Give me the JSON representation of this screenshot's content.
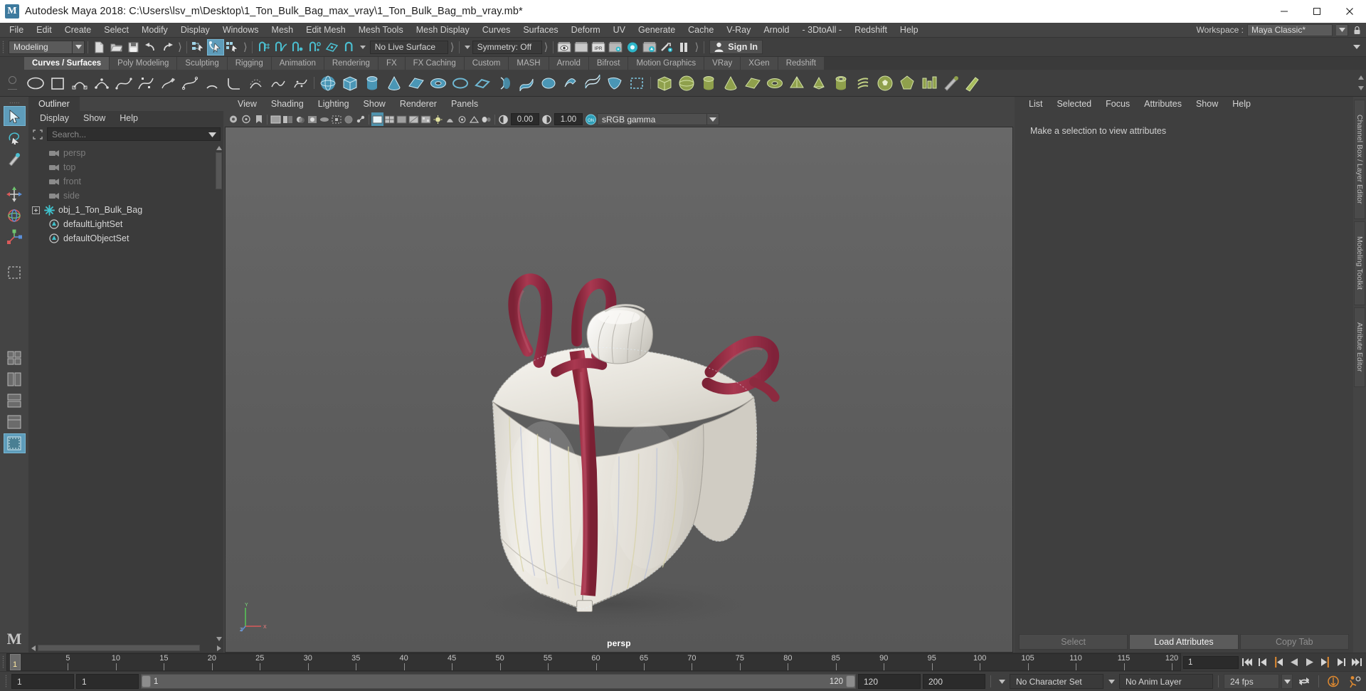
{
  "window": {
    "title": "Autodesk Maya 2018: C:\\Users\\lsv_m\\Desktop\\1_Ton_Bulk_Bag_max_vray\\1_Ton_Bulk_Bag_mb_vray.mb*",
    "logo_letter": "M",
    "minimize": "─",
    "maximize": "□",
    "close": "✕"
  },
  "menubar": {
    "items": [
      "File",
      "Edit",
      "Create",
      "Select",
      "Modify",
      "Display",
      "Windows",
      "Mesh",
      "Edit Mesh",
      "Mesh Tools",
      "Mesh Display",
      "Curves",
      "Surfaces",
      "Deform",
      "UV",
      "Generate",
      "Cache",
      "V-Ray",
      "Arnold",
      "- 3DtoAll -",
      "Redshift",
      "Help"
    ],
    "workspace_label": "Workspace :",
    "workspace_value": "Maya Classic*"
  },
  "statusline": {
    "mode": "Modeling",
    "live_surface": "No Live Surface",
    "symmetry": "Symmetry: Off",
    "signin": "Sign In",
    "icons": [
      "new-scene-icon",
      "open-scene-icon",
      "save-scene-icon",
      "undo-icon",
      "redo-icon",
      "select-by-hierarchy-icon",
      "select-by-object-icon",
      "select-by-component-icon",
      "snap-to-grid-icon",
      "snap-to-curve-icon",
      "snap-to-point-icon",
      "snap-to-projected-center-icon",
      "snap-to-view-plane-icon",
      "magnet-icon",
      "render-current-frame-icon",
      "render-sequence-icon",
      "ipr-render-icon",
      "render-settings-icon",
      "hypershade-icon",
      "render-view-icon",
      "render-setup-icon",
      "pause-render-icon"
    ]
  },
  "shelf": {
    "tabs": [
      "Curves / Surfaces",
      "Poly Modeling",
      "Sculpting",
      "Rigging",
      "Animation",
      "Rendering",
      "FX",
      "FX Caching",
      "Custom",
      "MASH",
      "Arnold",
      "Bifrost",
      "Motion Graphics",
      "VRay",
      "XGen",
      "Redshift"
    ],
    "selected_tab": "Curves / Surfaces"
  },
  "toolbox": {
    "items": [
      "select-tool",
      "lasso-select-tool",
      "paint-select-tool",
      "move-tool",
      "rotate-tool",
      "scale-tool",
      "last-tool",
      "four-view-layout",
      "persp-outliner-layout",
      "persp-graph-layout",
      "persp-hypershade-layout",
      "single-perspective-layout"
    ]
  },
  "outliner": {
    "tab_label": "Outliner",
    "menus": [
      "Display",
      "Show",
      "Help"
    ],
    "search_placeholder": "Search...",
    "search_value": "",
    "items": [
      {
        "label": "persp",
        "icon": "camera-icon",
        "dim": true,
        "expander": false
      },
      {
        "label": "top",
        "icon": "camera-icon",
        "dim": true,
        "expander": false
      },
      {
        "label": "front",
        "icon": "camera-icon",
        "dim": true,
        "expander": false
      },
      {
        "label": "side",
        "icon": "camera-icon",
        "dim": true,
        "expander": false
      },
      {
        "label": "obj_1_Ton_Bulk_Bag",
        "icon": "transform-icon",
        "dim": false,
        "expander": true
      },
      {
        "label": "defaultLightSet",
        "icon": "set-icon",
        "dim": false,
        "expander": false
      },
      {
        "label": "defaultObjectSet",
        "icon": "set-icon",
        "dim": false,
        "expander": false
      }
    ]
  },
  "viewport": {
    "menus": [
      "View",
      "Shading",
      "Lighting",
      "Show",
      "Renderer",
      "Panels"
    ],
    "camera_label": "persp",
    "exposure": "0.00",
    "gamma": "1.00",
    "color_space": "sRGB gamma",
    "gamma_toggle": "ON",
    "axis_labels": {
      "y": "Y",
      "x": "X",
      "z": "Z"
    }
  },
  "attribute_editor": {
    "menus": [
      "List",
      "Selected",
      "Focus",
      "Attributes",
      "Show",
      "Help"
    ],
    "empty_message": "Make a selection to view attributes",
    "buttons": [
      "Select",
      "Load Attributes",
      "Copy Tab"
    ],
    "active_button": "Load Attributes"
  },
  "right_tabs": [
    "Channel Box / Layer Editor",
    "Modeling Toolkit",
    "Attribute Editor"
  ],
  "timeline": {
    "current_frame": "1",
    "ticks": [
      5,
      10,
      15,
      20,
      25,
      30,
      35,
      40,
      45,
      50,
      55,
      60,
      65,
      70,
      75,
      80,
      85,
      90,
      95,
      100,
      105,
      110,
      115,
      120
    ],
    "range_start": 1,
    "range_end": 120,
    "playback_buttons": [
      "go-to-start-icon",
      "step-back-frame-icon",
      "step-back-key-icon",
      "play-backwards-icon",
      "play-forwards-icon",
      "step-forward-key-icon",
      "step-forward-frame-icon",
      "go-to-end-icon"
    ]
  },
  "bottombar": {
    "anim_start": "1",
    "range_start": "1",
    "slider_left": "1",
    "slider_right": "120",
    "range_end": "120",
    "anim_end": "200",
    "character_set": "No Character Set",
    "anim_layer": "No Anim Layer",
    "fps": "24 fps",
    "icons": [
      "auto-keyframe-toggle-icon",
      "animation-preferences-icon",
      "loop-playback-icon"
    ]
  },
  "colors": {
    "accent": "#5e9cba",
    "panel_bg": "#3f3f3f",
    "viewport_bg": "#636363",
    "bag_fabric": "#eceae4",
    "bag_strap": "#9e2f46"
  }
}
